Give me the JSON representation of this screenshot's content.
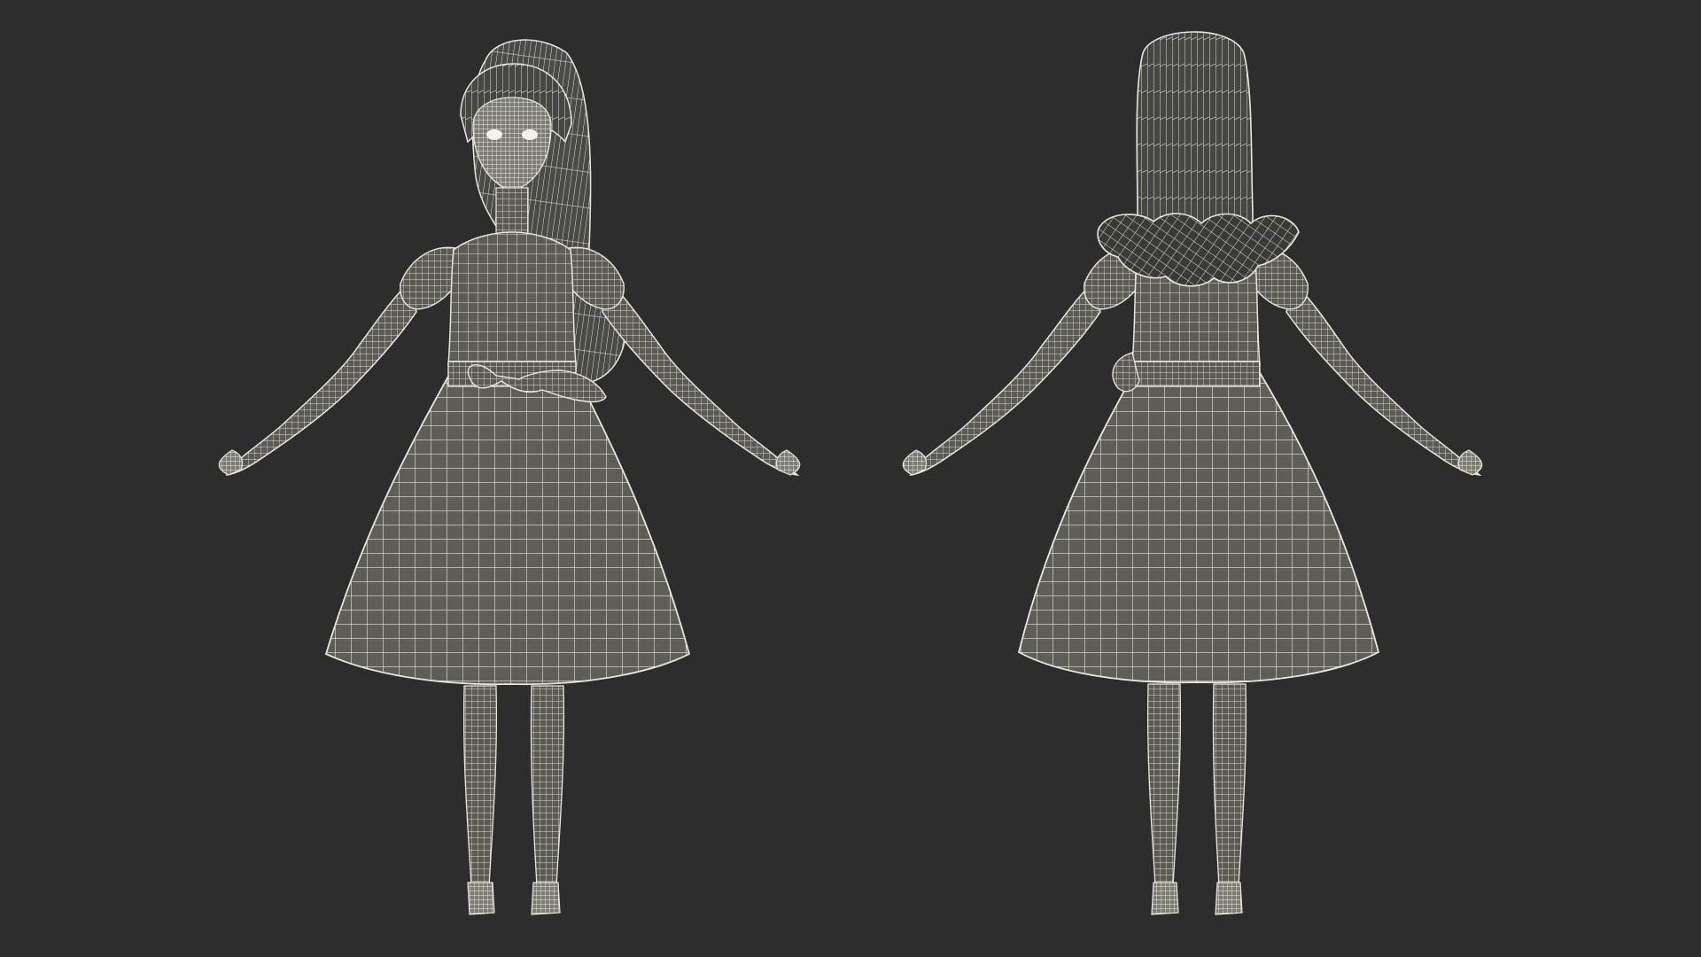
{
  "scene": {
    "background_color": "#2d2d2d",
    "wire_color": "#e9e7dc",
    "fill_color": "#5f5e58",
    "dark_fill_color": "#3b3b38",
    "views": [
      {
        "name": "front-view",
        "orientation": "front"
      },
      {
        "name": "back-view",
        "orientation": "back"
      }
    ]
  }
}
